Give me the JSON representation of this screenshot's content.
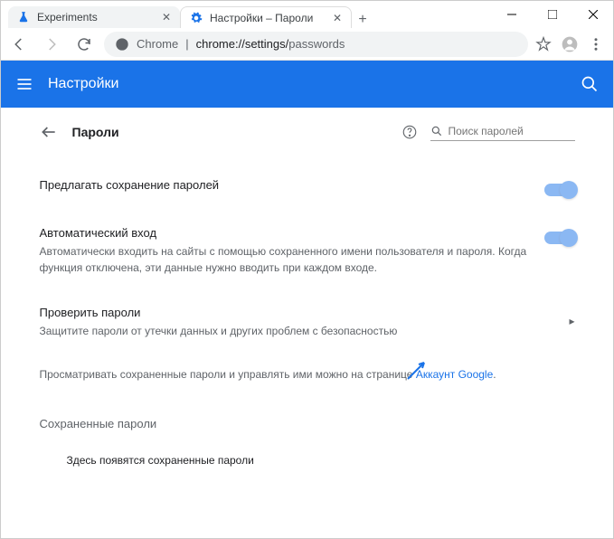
{
  "window": {
    "tabs": [
      {
        "label": "Experiments",
        "favicon": "flask"
      },
      {
        "label": "Настройки – Пароли",
        "favicon": "gear"
      }
    ]
  },
  "toolbar": {
    "url_prefix": "Chrome",
    "url_host": "chrome://settings/",
    "url_path": "passwords"
  },
  "appbar": {
    "title": "Настройки"
  },
  "page": {
    "title": "Пароли",
    "search_placeholder": "Поиск паролей",
    "rows": {
      "offer": {
        "label": "Предлагать сохранение паролей"
      },
      "autosignin": {
        "label": "Автоматический вход",
        "desc": "Автоматически входить на сайты с помощью сохраненного имени пользователя и пароля. Когда функция отключена, эти данные нужно вводить при каждом входе."
      },
      "check": {
        "label": "Проверить пароли",
        "desc": "Защитите пароли от утечки данных и других проблем с безопасностью"
      }
    },
    "manage_text": "Просматривать сохраненные пароли и управлять ими можно на странице ",
    "manage_link": "Аккаунт Google",
    "saved_section": "Сохраненные пароли",
    "saved_empty": "Здесь появятся сохраненные пароли"
  }
}
